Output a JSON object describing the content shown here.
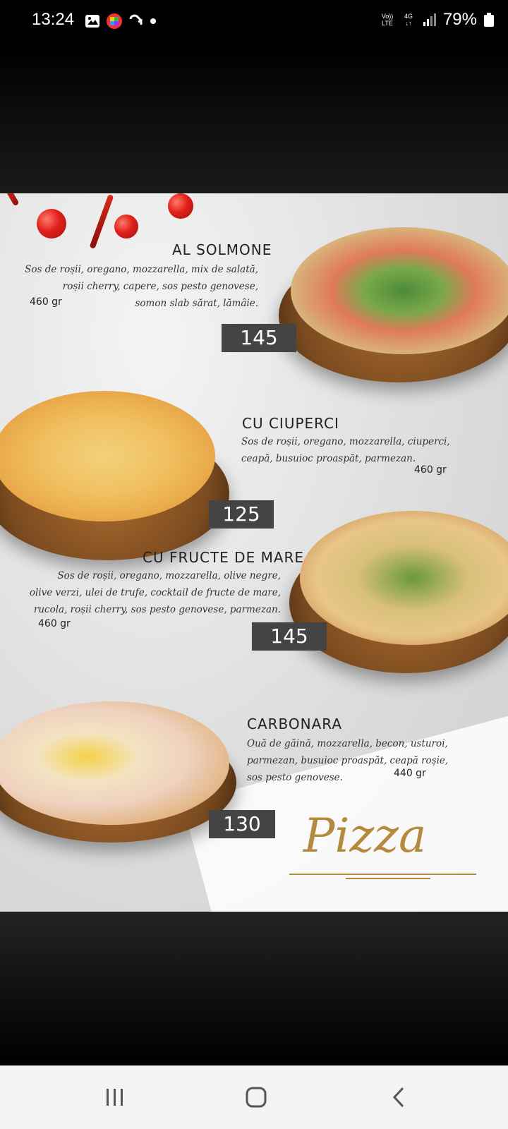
{
  "status_bar": {
    "time": "13:24",
    "battery": "79%",
    "network_volte": "Vo)) LTE",
    "network_type": "4G"
  },
  "menu": {
    "items": [
      {
        "name": "AL SOLMONE",
        "desc": [
          "Sos de roșii, oregano, mozzarella, mix de salată,",
          "roșii cherry, capere, sos pesto genovese,",
          "somon slab sărat, lămâie."
        ],
        "weight": "460 gr",
        "price": "145"
      },
      {
        "name": "CU CIUPERCI",
        "desc": [
          "Sos de roșii, oregano, mozzarella, ciuperci,",
          "ceapă, busuioc proaspăt, parmezan."
        ],
        "weight": "460 gr",
        "price": "125"
      },
      {
        "name": "CU FRUCTE DE MARE",
        "desc": [
          "Sos de roșii, oregano, mozzarella, olive negre,",
          "olive verzi, ulei de trufe, cocktail de fructe de mare,",
          "rucola, roșii cherry, sos pesto genovese, parmezan."
        ],
        "weight": "460 gr",
        "price": "145"
      },
      {
        "name": "CARBONARA",
        "desc": [
          "Ouă de găină, mozzarella, becon, usturoi,",
          "parmezan, busuioc proaspăt, ceapă roșie,",
          "sos pesto genovese."
        ],
        "weight": "440 gr",
        "price": "130"
      }
    ],
    "footer_title": "Pizza"
  },
  "colors": {
    "price_bg": "#444444",
    "gold": "#b48a3e"
  },
  "nav": {
    "recent": "recent-apps-icon",
    "home": "home-icon",
    "back": "back-icon"
  }
}
